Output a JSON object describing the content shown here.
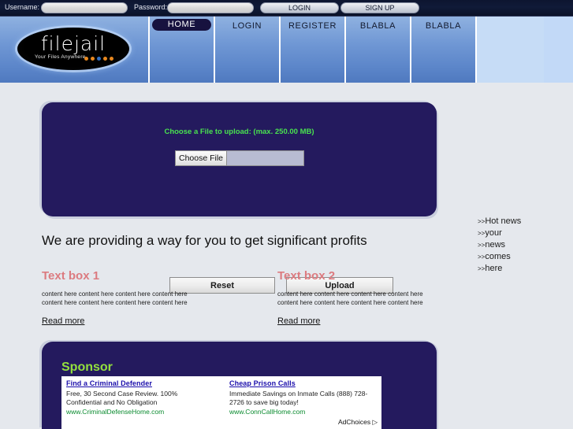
{
  "topbar": {
    "username_label": "Username:",
    "username_value": "",
    "username_placeholder": "",
    "password_label": "Password:",
    "password_value": "",
    "password_placeholder": "",
    "login_button": "LOGIN",
    "signup_button": "SIGN UP"
  },
  "brand": {
    "wordmark": "filejail",
    "tagline": "Your Files Anywhere",
    "dot_colors": [
      "#e8881f",
      "#e8881f",
      "#2f6fc4",
      "#e8881f",
      "#e8881f"
    ]
  },
  "nav": {
    "items": [
      {
        "label": "HOME",
        "active": true
      },
      {
        "label": "LOGIN",
        "active": false
      },
      {
        "label": "REGISTER",
        "active": false
      },
      {
        "label": "BLABLA",
        "active": false
      },
      {
        "label": "BLABLA",
        "active": false
      }
    ]
  },
  "upload": {
    "title": "Choose a File to upload: (max. 250.00 MB)",
    "choose_file_button": "Choose File",
    "file_value": "",
    "reset_button": "Reset",
    "upload_button": "Upload",
    "title_color": "#49e24f",
    "panel_color": "#241a5e"
  },
  "main": {
    "headline": "We are providing a way for you to get significant profits",
    "textboxes": [
      {
        "title": "Text box 1",
        "body": "content here content here content here content here content here content here content here content here",
        "read_more": "Read more"
      },
      {
        "title": "Text box 2",
        "body": "content here content here content here content here content here content here content here content here",
        "read_more": "Read more"
      }
    ],
    "textbox_title_color": "#dc7b80"
  },
  "news": {
    "items": [
      {
        "arrows": ">>",
        "text": "Hot news"
      },
      {
        "arrows": ">>",
        "text": "your"
      },
      {
        "arrows": ">>",
        "text": "news"
      },
      {
        "arrows": ">>",
        "text": "comes"
      },
      {
        "arrows": ">>",
        "text": "here"
      }
    ]
  },
  "sponsor": {
    "title": "Sponsor",
    "title_color": "#93e03e",
    "adchoices_label": "AdChoices",
    "ads": [
      {
        "headline": "Find a Criminal Defender",
        "description": "Free, 30 Second Case Review. 100% Confidential and No Obligation",
        "url": "www.CriminalDefenseHome.com"
      },
      {
        "headline": "Cheap Prison Calls",
        "description": "Immediate Savings on Inmate Calls (888) 728-2726 to save big today!",
        "url": "www.ConnCallHome.com"
      }
    ]
  }
}
